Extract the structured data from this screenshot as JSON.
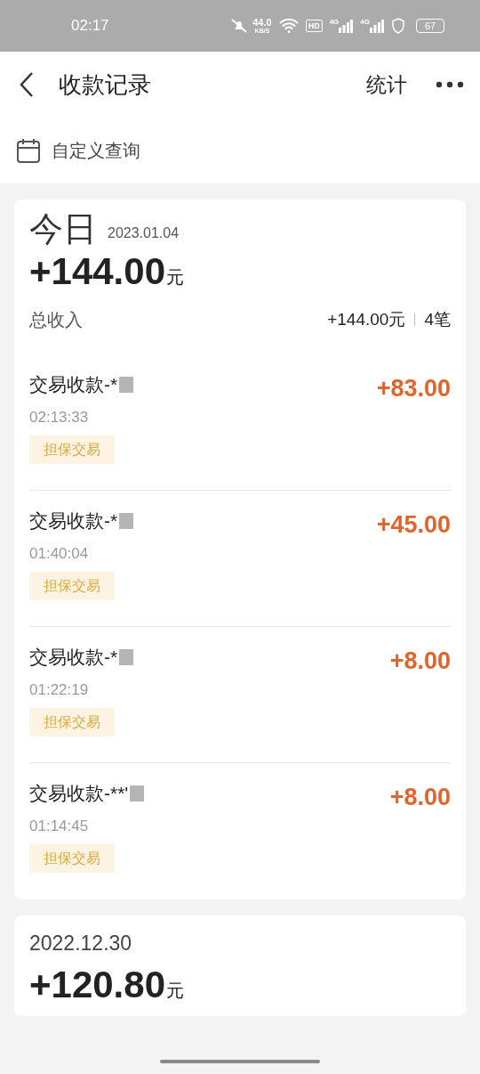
{
  "status_bar": {
    "time": "02:17",
    "speed": "44.0",
    "speed_unit": "KB/S",
    "hd": "HD",
    "sim1": "4G",
    "sim2": "4G",
    "battery": "67"
  },
  "header": {
    "title": "收款记录",
    "action": "统计"
  },
  "filter": {
    "label": "自定义查询"
  },
  "days": [
    {
      "title": "今日",
      "date": "2023.01.04",
      "amount": "+144.00",
      "unit": "元",
      "income_label": "总收入",
      "income_total": "+144.00元",
      "count": "4笔",
      "items": [
        {
          "name": "交易收款-*",
          "time": "02:13:33",
          "tag": "担保交易",
          "amount": "+83.00"
        },
        {
          "name": "交易收款-*",
          "time": "01:40:04",
          "tag": "担保交易",
          "amount": "+45.00"
        },
        {
          "name": "交易收款-*",
          "time": "01:22:19",
          "tag": "担保交易",
          "amount": "+8.00"
        },
        {
          "name": "交易收款-**'",
          "time": "01:14:45",
          "tag": "担保交易",
          "amount": "+8.00"
        }
      ]
    },
    {
      "date": "2022.12.30",
      "amount": "+120.80",
      "unit": "元"
    }
  ]
}
